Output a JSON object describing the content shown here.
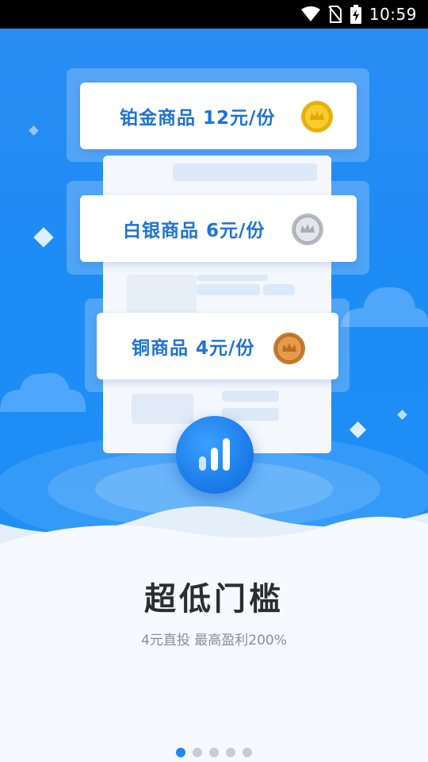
{
  "status_bar": {
    "time": "10:59",
    "icons": [
      "wifi-icon",
      "no-sim-icon",
      "battery-charging-icon"
    ]
  },
  "cards": [
    {
      "label": "铂金商品  12元/份",
      "coin": "gold-coin-icon",
      "coin_color": "#f2c21d"
    },
    {
      "label": "白银商品  6元/份",
      "coin": "silver-coin-icon",
      "coin_color": "#cfd3d8"
    },
    {
      "label": "铜商品  4元/份",
      "coin": "bronze-coin-icon",
      "coin_color": "#d98b3a"
    }
  ],
  "center_badge_icon": "bar-chart-icon",
  "headline": "超低门槛",
  "subline": "4元直投 最高盈利200%",
  "pager": {
    "total": 5,
    "active_index": 0
  },
  "colors": {
    "primary": "#1e88f5",
    "card_text": "#1f72d6"
  }
}
